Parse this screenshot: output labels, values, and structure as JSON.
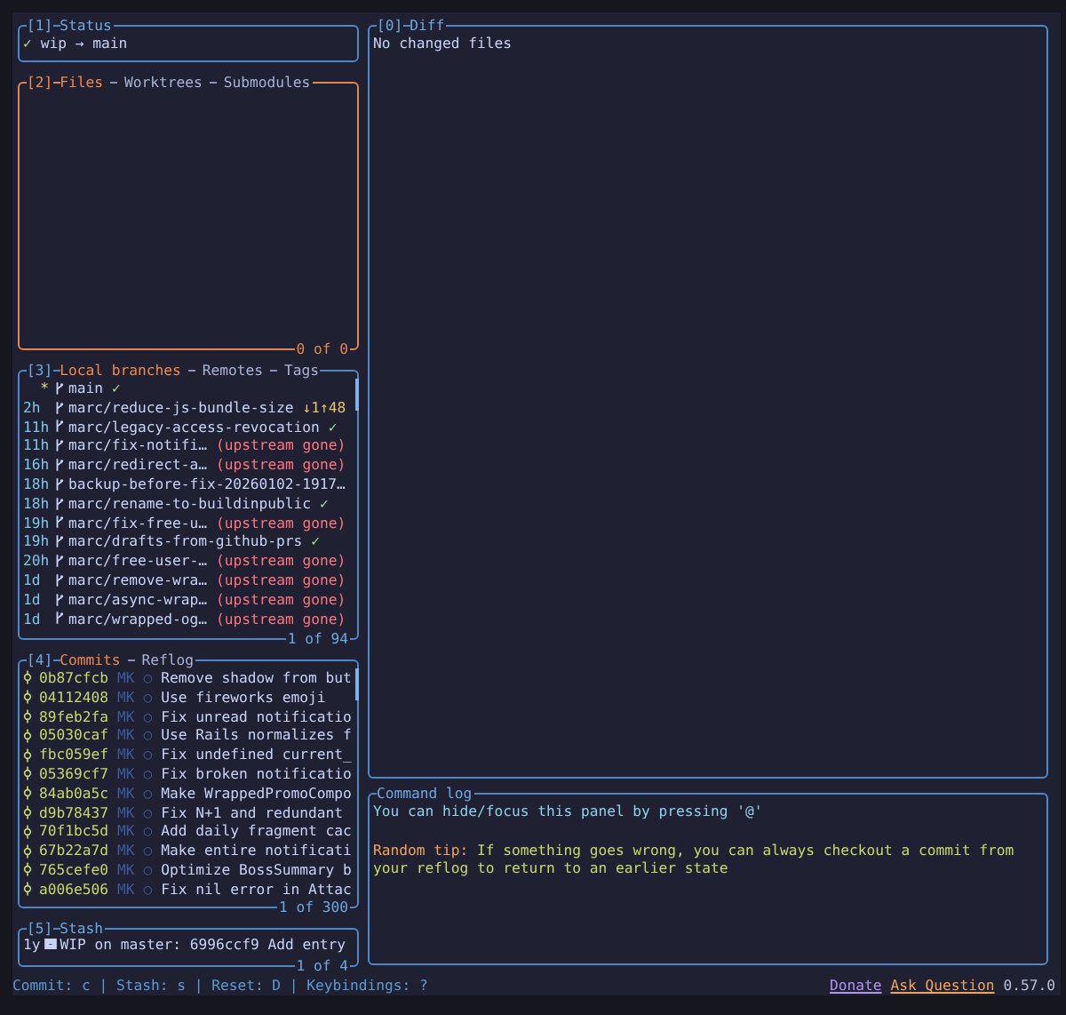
{
  "status": {
    "number": "[1]",
    "title": "Status",
    "check": "✓",
    "text": "wip → main",
    "active": false
  },
  "files": {
    "number": "[2]",
    "active": true,
    "tabs": [
      {
        "label": "Files",
        "selected": true
      },
      {
        "label": "Worktrees",
        "selected": false
      },
      {
        "label": "Submodules",
        "selected": false
      }
    ],
    "footer": "0 of 0"
  },
  "branches": {
    "number": "[3]",
    "active": false,
    "tabs": [
      {
        "label": "Local branches",
        "selected": true
      },
      {
        "label": "Remotes",
        "selected": false
      },
      {
        "label": "Tags",
        "selected": false
      }
    ],
    "footer": "1 of 94",
    "rows": [
      {
        "marker": "*",
        "name": "main",
        "status": "✓",
        "kind": "check"
      },
      {
        "time": "2h",
        "name": "marc/reduce-js-bundle-size",
        "status": "↓1↑48",
        "kind": "ahead"
      },
      {
        "time": "11h",
        "name": "marc/legacy-access-revocation",
        "status": "✓",
        "kind": "check"
      },
      {
        "time": "11h",
        "name": "marc/fix-notifi…",
        "status": "(upstream gone)",
        "kind": "gone"
      },
      {
        "time": "16h",
        "name": "marc/redirect-a…",
        "status": "(upstream gone)",
        "kind": "gone"
      },
      {
        "time": "18h",
        "name": "backup-before-fix-20260102-1917…"
      },
      {
        "time": "18h",
        "name": "marc/rename-to-buildinpublic",
        "status": "✓",
        "kind": "check"
      },
      {
        "time": "19h",
        "name": "marc/fix-free-u…",
        "status": "(upstream gone)",
        "kind": "gone"
      },
      {
        "time": "19h",
        "name": "marc/drafts-from-github-prs",
        "status": "✓",
        "kind": "check"
      },
      {
        "time": "20h",
        "name": "marc/free-user-…",
        "status": "(upstream gone)",
        "kind": "gone"
      },
      {
        "time": "1d",
        "name": "marc/remove-wra…",
        "status": "(upstream gone)",
        "kind": "gone"
      },
      {
        "time": "1d",
        "name": "marc/async-wrap…",
        "status": "(upstream gone)",
        "kind": "gone"
      },
      {
        "time": "1d",
        "name": "marc/wrapped-og…",
        "status": "(upstream gone)",
        "kind": "gone"
      }
    ]
  },
  "commits": {
    "number": "[4]",
    "active": false,
    "tabs": [
      {
        "label": "Commits",
        "selected": true
      },
      {
        "label": "Reflog",
        "selected": false
      }
    ],
    "footer": "1 of 300",
    "rows": [
      {
        "hash": "0b87cfcb",
        "author": "MK",
        "graph": "○",
        "message": "Remove shadow from but"
      },
      {
        "hash": "04112408",
        "author": "MK",
        "graph": "○",
        "message": "Use fireworks emoji"
      },
      {
        "hash": "89feb2fa",
        "author": "MK",
        "graph": "○",
        "message": "Fix unread notificatio"
      },
      {
        "hash": "05030caf",
        "author": "MK",
        "graph": "○",
        "message": "Use Rails normalizes f"
      },
      {
        "hash": "fbc059ef",
        "author": "MK",
        "graph": "○",
        "message": "Fix undefined current_"
      },
      {
        "hash": "05369cf7",
        "author": "MK",
        "graph": "○",
        "message": "Fix broken notificatio"
      },
      {
        "hash": "84ab0a5c",
        "author": "MK",
        "graph": "○",
        "message": "Make WrappedPromoCompo"
      },
      {
        "hash": "d9b78437",
        "author": "MK",
        "graph": "○",
        "message": "Fix N+1 and redundant"
      },
      {
        "hash": "70f1bc5d",
        "author": "MK",
        "graph": "○",
        "message": "Add daily fragment cac"
      },
      {
        "hash": "67b22a7d",
        "author": "MK",
        "graph": "○",
        "message": "Make entire notificati"
      },
      {
        "hash": "765cefe0",
        "author": "MK",
        "graph": "○",
        "message": "Optimize BossSummary b"
      },
      {
        "hash": "a006e506",
        "author": "MK",
        "graph": "○",
        "message": "Fix nil error in Attac"
      }
    ]
  },
  "stash": {
    "number": "[5]",
    "title": "Stash",
    "active": false,
    "footer": "1 of 4",
    "rows": [
      {
        "time": "1y",
        "text": "WIP on master: 6996ccf9 Add entry"
      }
    ]
  },
  "diff": {
    "number": "[0]",
    "title": "Diff",
    "active": false,
    "text": "No changed files"
  },
  "command_log": {
    "title": "Command log",
    "active": false,
    "hint": "You can hide/focus this panel by pressing '@'",
    "tip_label": "Random tip:",
    "tip_text": "If something goes wrong, you can always checkout a commit from your reflog to return to an earlier state"
  },
  "status_bar": {
    "keys": "Commit: c | Stash: s | Reset: D | Keybindings: ?",
    "donate": "Donate",
    "ask": "Ask Question",
    "version": "0.57.0"
  }
}
